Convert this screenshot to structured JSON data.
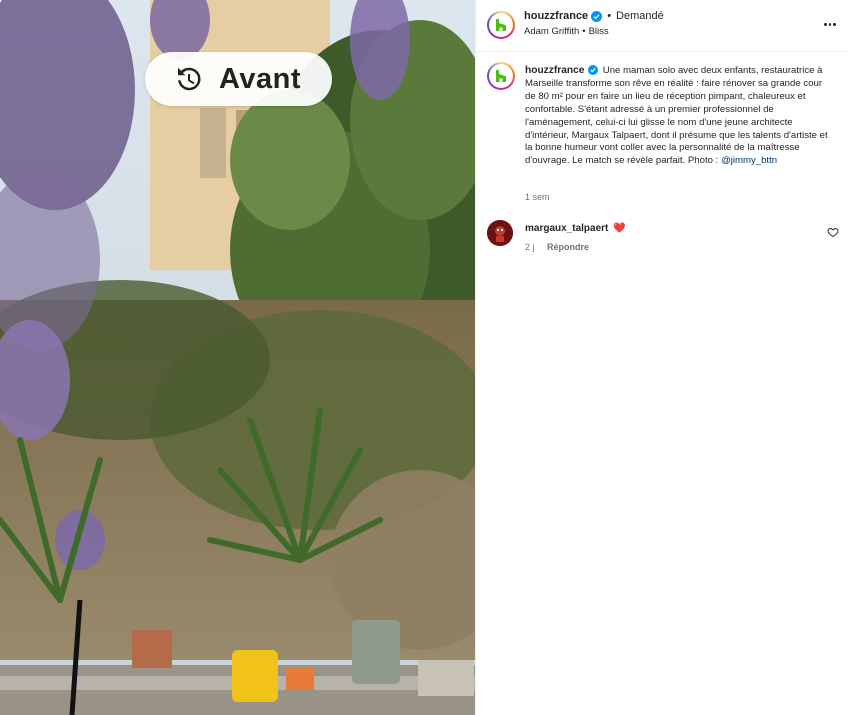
{
  "media": {
    "badge_label": "Avant",
    "badge_icon": "history-clock-icon"
  },
  "post_header": {
    "username": "houzzfrance",
    "status": "Demandé",
    "audio_artist": "Adam Griffith",
    "audio_title": "Bliss",
    "more_icon": "more-options-icon"
  },
  "caption": {
    "username": "houzzfrance",
    "text": "Une maman solo avec deux enfants, restauratrice à Marseille transforme son rêve en réalité : faire rénover sa grande cour de 80 m² pour en faire un lieu de réception pimpant, chaleureux et confortable. S'étant adressé à un premier professionnel de l'aménagement, celui-ci lui glisse le nom d'une jeune architecte d'intérieur, Margaux Talpaert, dont il présume que les talents d'artiste et la bonne humeur vont coller avec la personnalité de la maîtresse d'ouvrage. Le match se révèle parfait. Photo :",
    "mention": "@jimmy_bttn",
    "time": "1 sem"
  },
  "comments": [
    {
      "username": "margaux_talpaert",
      "emoji": "❤️",
      "time": "2 j",
      "reply_label": "Répondre"
    }
  ],
  "colors": {
    "houzz_green": "#4dbc15",
    "verified_blue": "#0095f6",
    "link_blue": "#00376b",
    "secondary_text": "#737373"
  }
}
